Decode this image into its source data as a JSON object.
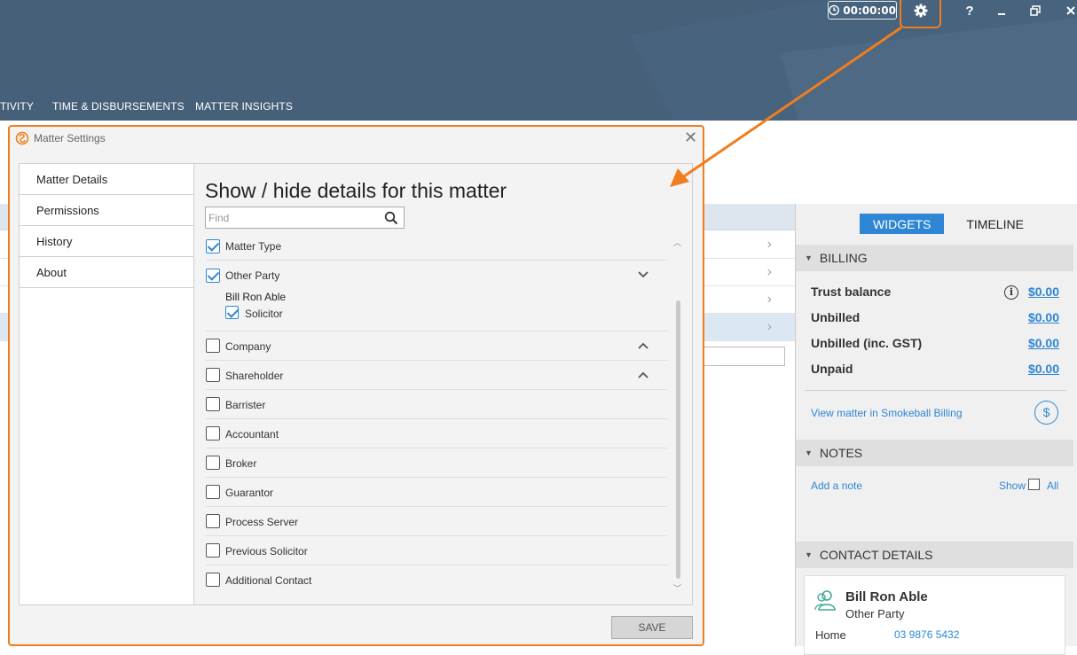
{
  "header": {
    "timer": "00:00:00",
    "tabs": [
      "TIVITY",
      "TIME & DISBURSEMENTS",
      "MATTER INSIGHTS"
    ],
    "help_label": "?"
  },
  "dialog": {
    "title": "Matter Settings",
    "nav": [
      "Matter Details",
      "Permissions",
      "History",
      "About"
    ],
    "heading": "Show / hide details for this matter",
    "find_placeholder": "Find",
    "items": [
      {
        "label": "Matter Type",
        "checked": true
      },
      {
        "label": "Other Party",
        "checked": true,
        "expand": "down",
        "sub": {
          "name": "Bill Ron Able",
          "role": "Solicitor",
          "checked": true
        }
      },
      {
        "label": "Company",
        "checked": false,
        "expand": "up"
      },
      {
        "label": "Shareholder",
        "checked": false,
        "expand": "up"
      },
      {
        "label": "Barrister",
        "checked": false
      },
      {
        "label": "Accountant",
        "checked": false
      },
      {
        "label": "Broker",
        "checked": false
      },
      {
        "label": "Guarantor",
        "checked": false
      },
      {
        "label": "Process Server",
        "checked": false
      },
      {
        "label": "Previous Solicitor",
        "checked": false
      },
      {
        "label": "Additional Contact",
        "checked": false
      }
    ],
    "save_label": "SAVE"
  },
  "panel": {
    "tabs": {
      "widgets": "WIDGETS",
      "timeline": "TIMELINE"
    },
    "billing": {
      "title": "BILLING",
      "rows": [
        {
          "label": "Trust balance",
          "amount": "$0.00"
        },
        {
          "label": "Unbilled",
          "amount": "$0.00"
        },
        {
          "label": "Unbilled (inc. GST)",
          "amount": "$0.00"
        },
        {
          "label": "Unpaid",
          "amount": "$0.00"
        }
      ],
      "view_link": "View matter in Smokeball Billing"
    },
    "notes": {
      "title": "NOTES",
      "add": "Add a note",
      "show": "Show",
      "all": "All"
    },
    "contact": {
      "title": "CONTACT DETAILS",
      "name": "Bill Ron Able",
      "role": "Other Party",
      "phone_label": "Home",
      "phone": "03 9876 5432"
    }
  },
  "colors": {
    "accent": "#2f86d4",
    "highlight": "#f07d1e",
    "header": "#456078"
  }
}
